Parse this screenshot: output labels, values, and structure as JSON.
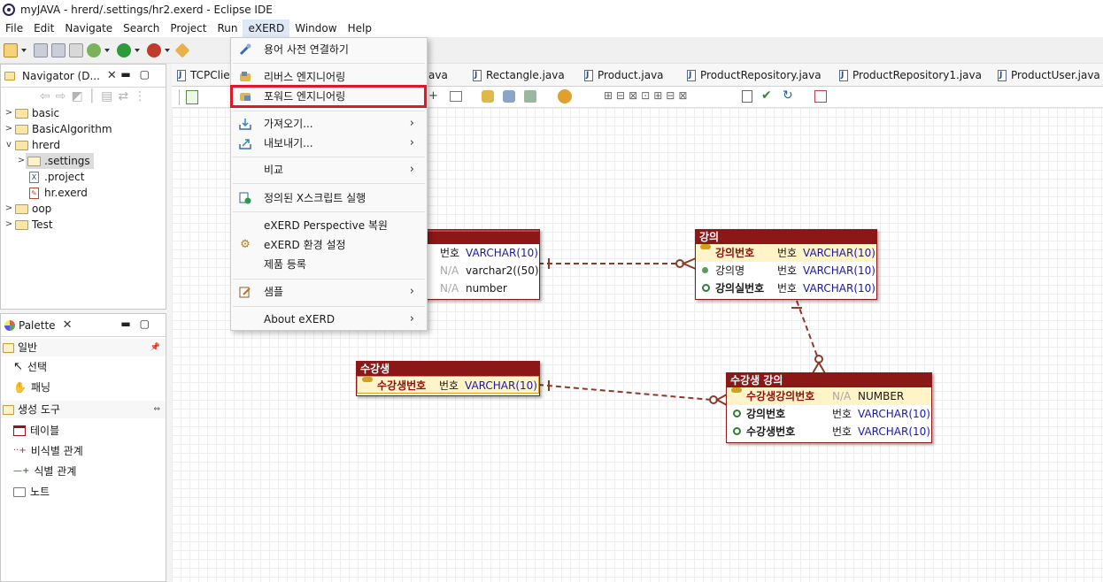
{
  "window": {
    "title": "myJAVA - hrerd/.settings/hr2.exerd - Eclipse IDE"
  },
  "menubar": [
    "File",
    "Edit",
    "Navigate",
    "Search",
    "Project",
    "Run",
    "eXERD",
    "Window",
    "Help"
  ],
  "navigator": {
    "tab_label": "Navigator (D...",
    "tree": [
      {
        "label": "basic",
        "kind": "folder",
        "caret": ">",
        "depth": 0
      },
      {
        "label": "BasicAlgorithm",
        "kind": "folder",
        "caret": ">",
        "depth": 0
      },
      {
        "label": "hrerd",
        "kind": "folder",
        "caret": "v",
        "depth": 0
      },
      {
        "label": ".settings",
        "kind": "folder-open",
        "caret": ">",
        "depth": 1,
        "selected": true
      },
      {
        "label": ".project",
        "kind": "file-x",
        "caret": "",
        "depth": 1
      },
      {
        "label": "hr.exerd",
        "kind": "file-erd",
        "caret": "",
        "depth": 1
      },
      {
        "label": "oop",
        "kind": "folder",
        "caret": ">",
        "depth": 0
      },
      {
        "label": "Test",
        "kind": "folder",
        "caret": ">",
        "depth": 0
      }
    ]
  },
  "palette": {
    "tab_label": "Palette",
    "sections": [
      {
        "label": "일반",
        "items": [
          "선택",
          "패닝"
        ]
      },
      {
        "label": "생성 도구",
        "items": [
          "테이블",
          "비식별 관계",
          "식별 관계",
          "노트"
        ]
      }
    ]
  },
  "editor_tabs": [
    "TCPClie",
    "ava",
    "Rectangle.java",
    "Product.java",
    "ProductRepository.java",
    "ProductRepository1.java",
    "ProductUser.java"
  ],
  "context_menu": {
    "items": [
      {
        "label": "용어 사전 연결하기",
        "icon": "link-icon",
        "submenu": false
      },
      {
        "label": "리버스 엔지니어링",
        "icon": "reverse-engineering-icon",
        "submenu": false
      },
      {
        "label": "포워드 엔지니어링",
        "icon": "forward-engineering-icon",
        "submenu": false,
        "highlighted": true
      },
      {
        "label": "가져오기...",
        "icon": "import-icon",
        "submenu": true
      },
      {
        "label": "내보내기...",
        "icon": "export-icon",
        "submenu": true
      },
      {
        "label": "비교",
        "icon": "",
        "submenu": true
      },
      {
        "label": "정의된 X스크립트 실행",
        "icon": "script-icon",
        "submenu": false
      },
      {
        "label": "eXERD Perspective 복원",
        "icon": "",
        "submenu": false
      },
      {
        "label": "eXERD 환경 설정",
        "icon": "gear-icon",
        "submenu": false
      },
      {
        "label": "제품 등록",
        "icon": "",
        "submenu": false
      },
      {
        "label": "샘플",
        "icon": "sample-icon",
        "submenu": true
      },
      {
        "label": "About eXERD",
        "icon": "",
        "submenu": true
      }
    ]
  },
  "erd": {
    "partial_table": {
      "rows": [
        {
          "type": "번호",
          "datatype": "VARCHAR(10)",
          "type_muted": false
        },
        {
          "type": "N/A",
          "datatype": "varchar2((50)",
          "type_muted": true
        },
        {
          "type": "N/A",
          "datatype": "number",
          "type_muted": true
        }
      ]
    },
    "tables": [
      {
        "id": "course",
        "title": "강의",
        "rows": [
          {
            "name": "강의번호",
            "key": "pk",
            "type": "번호",
            "datatype": "VARCHAR(10)"
          },
          {
            "name": "강의명",
            "key": "attr",
            "type": "번호",
            "datatype": "VARCHAR(10)"
          },
          {
            "name": "강의실번호",
            "key": "fk",
            "type": "번호",
            "datatype": "VARCHAR(10)"
          }
        ]
      },
      {
        "id": "student",
        "title": "수강생",
        "rows": [
          {
            "name": "수강생번호",
            "key": "pk",
            "type": "번호",
            "datatype": "VARCHAR(10)"
          }
        ]
      },
      {
        "id": "student_course",
        "title": "수강생 강의",
        "rows": [
          {
            "name": "수강생강의번호",
            "key": "pk",
            "type": "N/A",
            "datatype": "NUMBER"
          },
          {
            "name": "강의번호",
            "key": "fk",
            "type": "번호",
            "datatype": "VARCHAR(10)"
          },
          {
            "name": "수강생번호",
            "key": "fk",
            "type": "번호",
            "datatype": "VARCHAR(10)"
          }
        ]
      }
    ]
  },
  "colors": {
    "accent_red": "#e0162b",
    "table_header": "#8b1717",
    "relation": "#8b3a2a"
  }
}
